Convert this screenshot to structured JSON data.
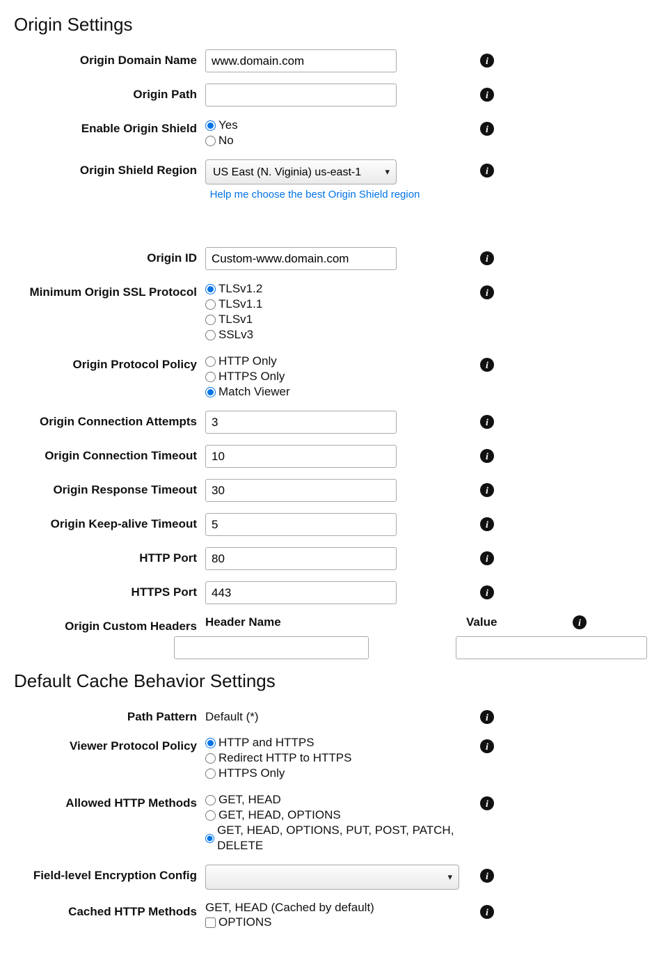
{
  "sections": {
    "origin": {
      "title": "Origin Settings"
    },
    "cache": {
      "title": "Default Cache Behavior Settings"
    }
  },
  "origin": {
    "domain_name": {
      "label": "Origin Domain Name",
      "value": "www.domain.com"
    },
    "path": {
      "label": "Origin Path",
      "value": ""
    },
    "enable_shield": {
      "label": "Enable Origin Shield",
      "options": {
        "yes": "Yes",
        "no": "No"
      },
      "selected": "yes"
    },
    "shield_region": {
      "label": "Origin Shield Region",
      "selected": "US East (N. Viginia) us-east-1",
      "help_link": "Help me choose the best Origin Shield region"
    },
    "origin_id": {
      "label": "Origin ID",
      "value": "Custom-www.domain.com"
    },
    "min_ssl": {
      "label": "Minimum Origin SSL Protocol",
      "options": {
        "tls12": "TLSv1.2",
        "tls11": "TLSv1.1",
        "tls1": "TLSv1",
        "ssl3": "SSLv3"
      },
      "selected": "tls12"
    },
    "protocol_policy": {
      "label": "Origin Protocol Policy",
      "options": {
        "http": "HTTP Only",
        "https": "HTTPS Only",
        "match": "Match Viewer"
      },
      "selected": "match"
    },
    "conn_attempts": {
      "label": "Origin Connection Attempts",
      "value": "3"
    },
    "conn_timeout": {
      "label": "Origin Connection Timeout",
      "value": "10"
    },
    "resp_timeout": {
      "label": "Origin Response Timeout",
      "value": "30"
    },
    "keepalive": {
      "label": "Origin Keep-alive Timeout",
      "value": "5"
    },
    "http_port": {
      "label": "HTTP Port",
      "value": "80"
    },
    "https_port": {
      "label": "HTTPS Port",
      "value": "443"
    },
    "custom_headers": {
      "label": "Origin Custom Headers",
      "header_name_label": "Header Name",
      "value_label": "Value",
      "name_value": "",
      "value_value": ""
    }
  },
  "cache": {
    "path_pattern": {
      "label": "Path Pattern",
      "value": "Default (*)"
    },
    "viewer_protocol": {
      "label": "Viewer Protocol Policy",
      "options": {
        "both": "HTTP and HTTPS",
        "redirect": "Redirect HTTP to HTTPS",
        "https": "HTTPS Only"
      },
      "selected": "both"
    },
    "allowed_methods": {
      "label": "Allowed HTTP Methods",
      "options": {
        "gh": "GET, HEAD",
        "gho": "GET, HEAD, OPTIONS",
        "all": "GET, HEAD, OPTIONS, PUT, POST, PATCH, DELETE"
      },
      "selected": "all"
    },
    "fle_config": {
      "label": "Field-level Encryption Config",
      "selected": ""
    },
    "cached_methods": {
      "label": "Cached HTTP Methods",
      "default_text": "GET, HEAD (Cached by default)",
      "options_label": "OPTIONS",
      "options_checked": false
    }
  }
}
